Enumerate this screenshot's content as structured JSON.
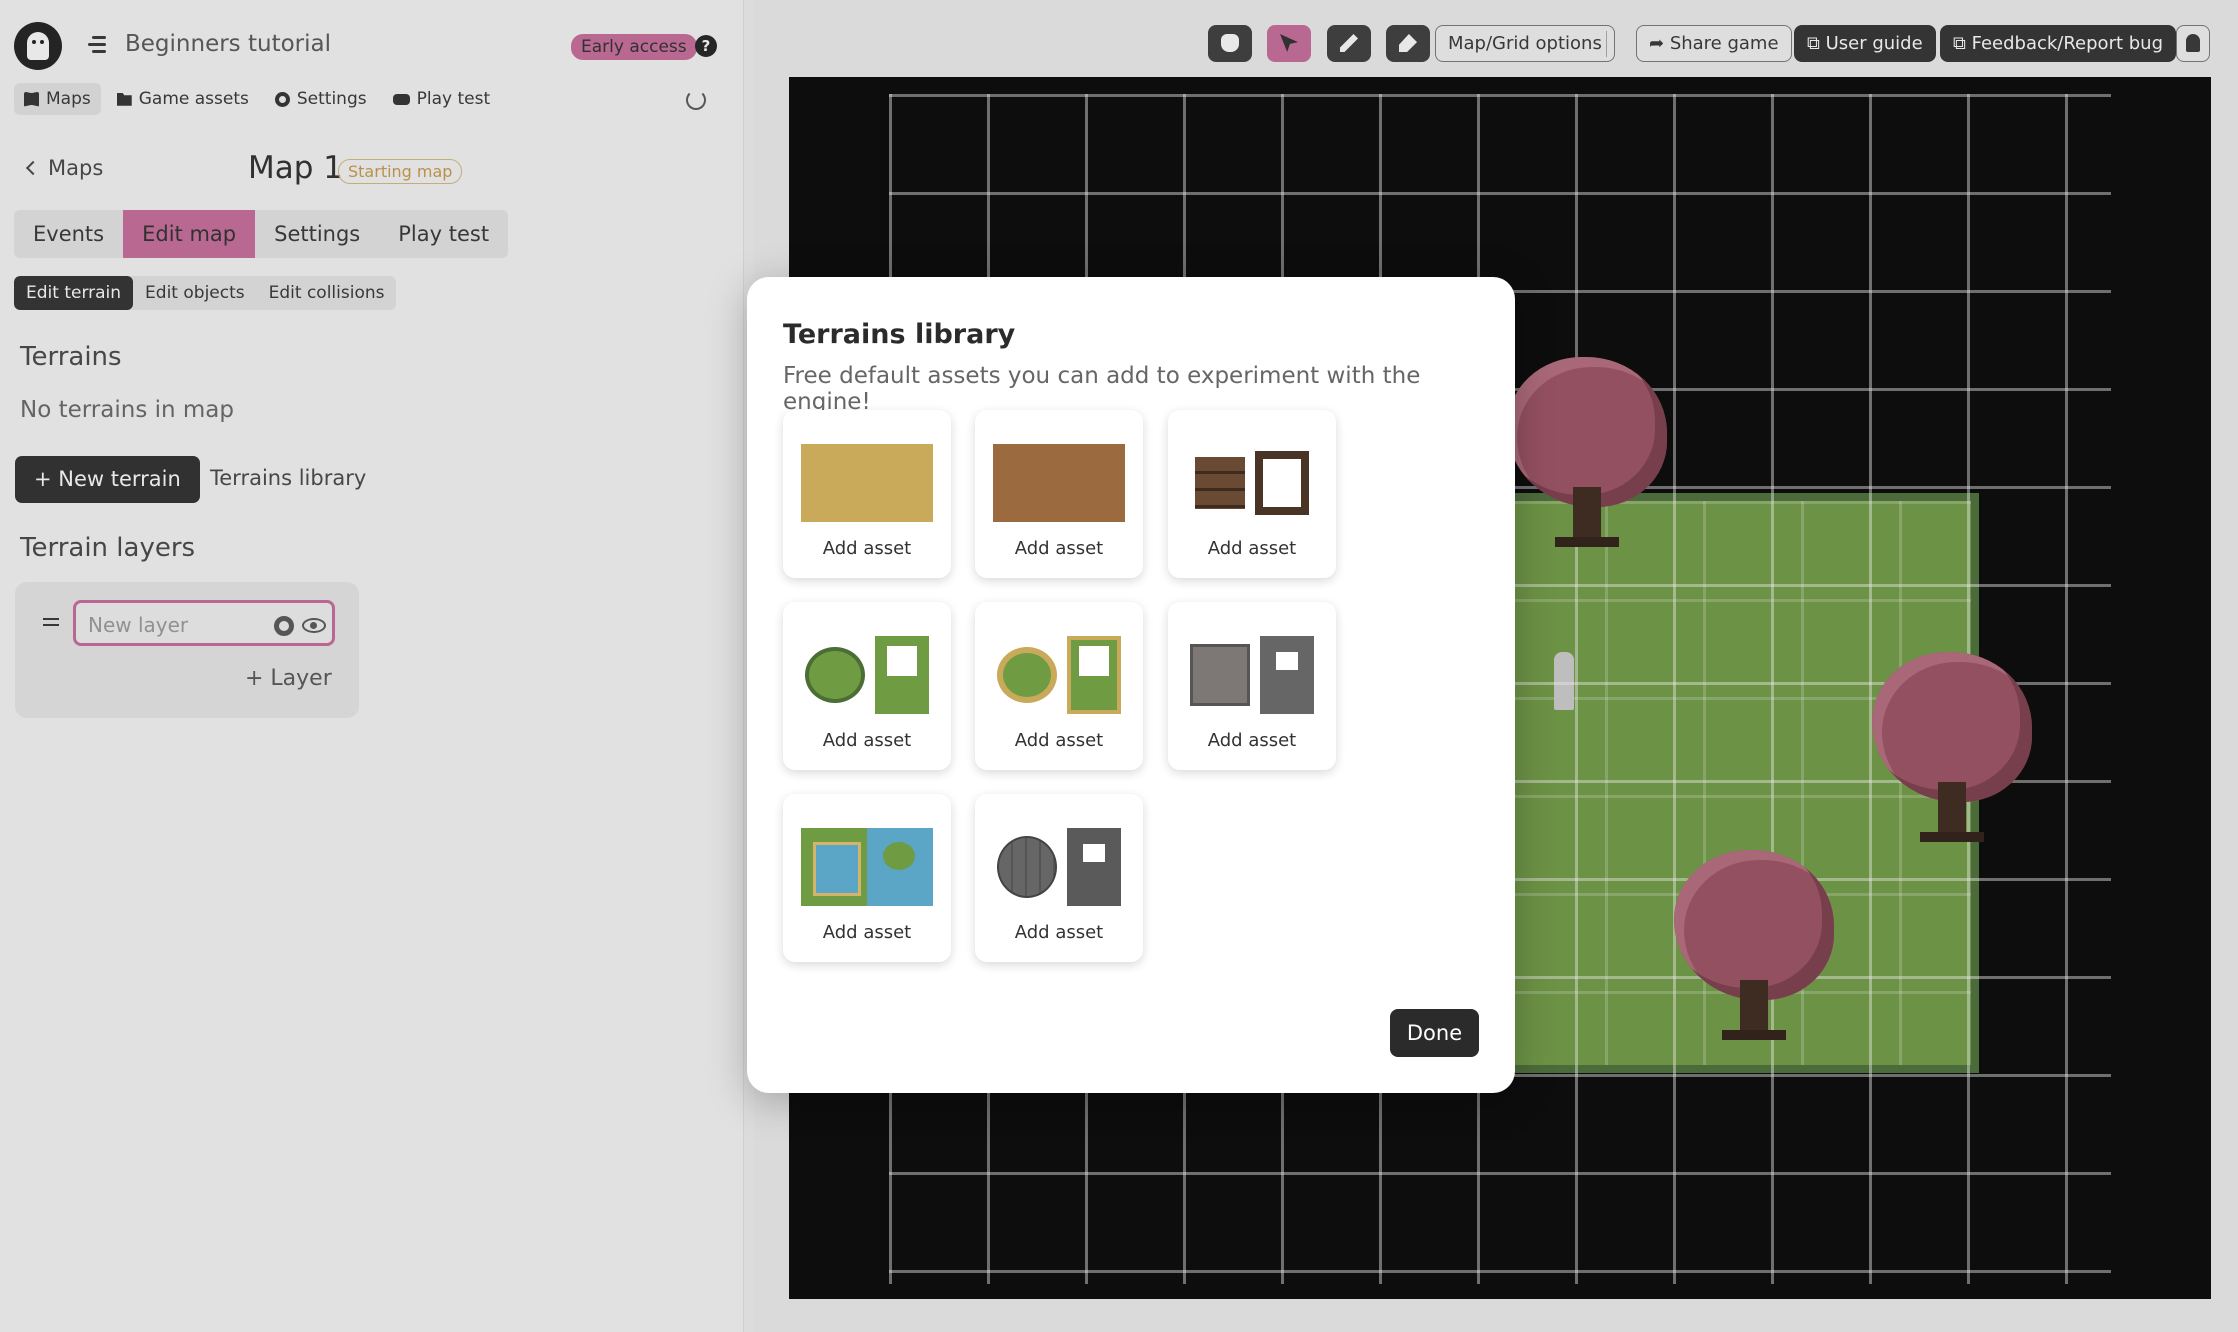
{
  "app": {
    "project_title": "Beginners tutorial",
    "early_access_badge": "Early access",
    "help_label": "?"
  },
  "topnav": [
    {
      "label": "Maps",
      "icon": "book-icon",
      "active": true
    },
    {
      "label": "Game assets",
      "icon": "folder-icon"
    },
    {
      "label": "Settings",
      "icon": "gear-icon"
    },
    {
      "label": "Play test",
      "icon": "gamepad-icon"
    }
  ],
  "map": {
    "back_label": "Maps",
    "title": "Map 1",
    "badge": "Starting map"
  },
  "tabs": [
    "Events",
    "Edit map",
    "Settings",
    "Play test"
  ],
  "active_tab": "Edit map",
  "subtabs": [
    "Edit terrain",
    "Edit objects",
    "Edit collisions"
  ],
  "active_subtab": "Edit terrain",
  "terrains": {
    "heading": "Terrains",
    "empty_text": "No terrains in map",
    "new_button": "+ New terrain",
    "library_link": "Terrains library"
  },
  "layers": {
    "heading": "Terrain layers",
    "input_placeholder": "New layer",
    "add_button": "+ Layer"
  },
  "toolbar": {
    "tools": [
      "hand-icon",
      "cursor-icon",
      "pencil-icon",
      "eraser-icon"
    ],
    "active_tool": "cursor-icon",
    "map_grid_options": "Map/Grid options",
    "share_game": "Share game",
    "user_guide": "User guide",
    "feedback": "Feedback/Report bug"
  },
  "modal": {
    "title": "Terrains library",
    "subtitle": "Free default assets you can add to experiment with the engine!",
    "assets": [
      {
        "label": "Add asset",
        "kind": "sand"
      },
      {
        "label": "Add asset",
        "kind": "dirt"
      },
      {
        "label": "Add asset",
        "kind": "wood"
      },
      {
        "label": "Add asset",
        "kind": "grass-bush"
      },
      {
        "label": "Add asset",
        "kind": "grass-sand-bush"
      },
      {
        "label": "Add asset",
        "kind": "stone"
      },
      {
        "label": "Add asset",
        "kind": "water"
      },
      {
        "label": "Add asset",
        "kind": "brick"
      }
    ],
    "done_button": "Done"
  },
  "colors": {
    "accent": "#c96b9b",
    "dark": "#2b2b2b",
    "grass": "#6f9b42",
    "tree": "#9c4f62"
  }
}
